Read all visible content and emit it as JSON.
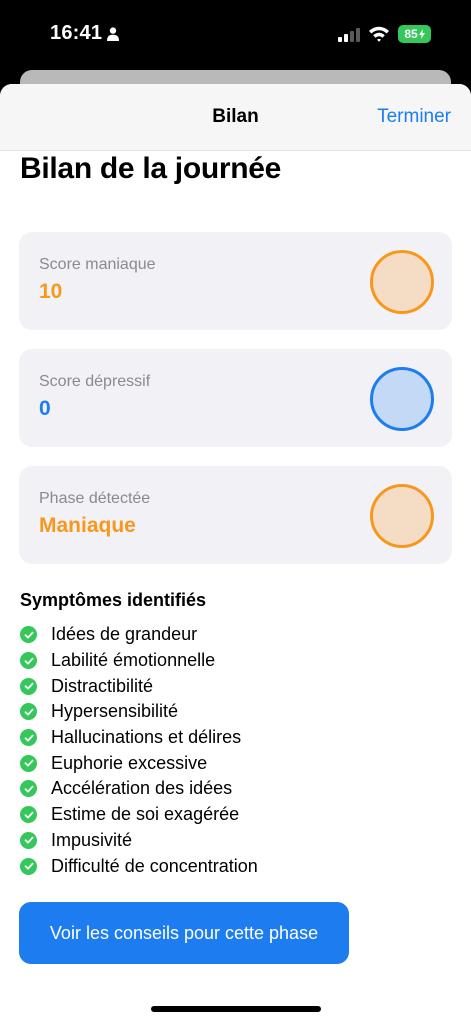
{
  "status_bar": {
    "time": "16:41",
    "battery": "85"
  },
  "nav": {
    "title": "Bilan",
    "done_label": "Terminer"
  },
  "page": {
    "title": "Bilan de la journée"
  },
  "cards": [
    {
      "label": "Score maniaque",
      "value": "10",
      "value_color": "#f7981c",
      "circle_fill": "#f5ddc5",
      "circle_stroke": "#f7981c"
    },
    {
      "label": "Score dépressif",
      "value": "0",
      "value_color": "#1c7cf0",
      "circle_fill": "#c3d9f5",
      "circle_stroke": "#1c7cf0"
    },
    {
      "label": "Phase détectée",
      "value": "Maniaque",
      "value_color": "#f7981c",
      "circle_fill": "#f5ddc5",
      "circle_stroke": "#f7981c"
    }
  ],
  "symptoms": {
    "title": "Symptômes identifiés",
    "items": [
      "Idées de grandeur",
      "Labilité émotionnelle",
      "Distractibilité",
      "Hypersensibilité",
      "Hallucinations et délires",
      "Euphorie excessive",
      "Accélération des idées",
      "Estime de soi exagérée",
      "Impusivité",
      "Difficulté de concentration"
    ]
  },
  "advice_button": {
    "label": "Voir les conseils pour cette phase"
  },
  "colors": {
    "accent": "#1c7cf0",
    "check": "#34c759",
    "manic": "#f7981c"
  }
}
